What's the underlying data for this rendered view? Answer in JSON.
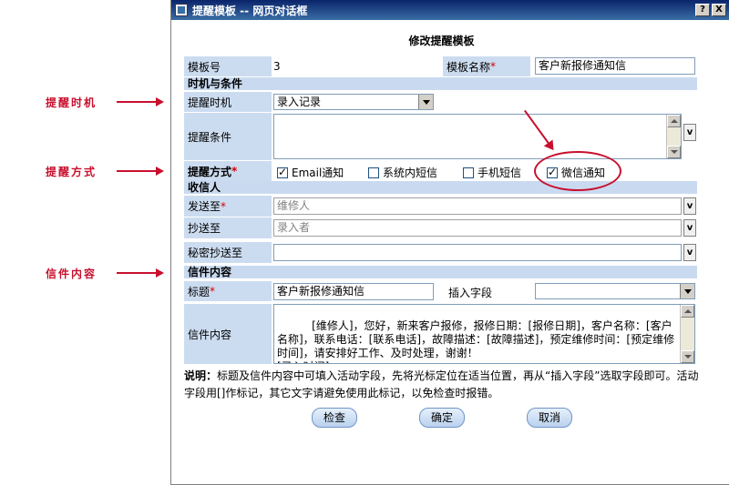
{
  "window": {
    "title": "提醒模板 -- 网页对话框",
    "help_btn": "?",
    "close_btn": "X"
  },
  "dialog_title": "修改提醒模板",
  "annotations": {
    "timing": "提醒时机",
    "method": "提醒方式",
    "content": "信件内容"
  },
  "fields": {
    "template_no_label": "模板号",
    "template_no_value": "3",
    "template_name_label": "模板名称",
    "template_name_value": "客户新报修通知信",
    "section_timing": "时机与条件",
    "timing_label": "提醒时机",
    "timing_value": "录入记录",
    "condition_label": "提醒条件",
    "condition_btn": "v",
    "method_label": "提醒方式",
    "method_email": "Email通知",
    "method_sms_internal": "系统内短信",
    "method_mobile": "手机短信",
    "method_wechat": "微信通知",
    "section_recipient": "收信人",
    "to_label": "发送至",
    "to_value": "维修人",
    "cc_label": "抄送至",
    "cc_value": "录入者",
    "bcc_label": "秘密抄送至",
    "bcc_value": "",
    "section_letter": "信件内容",
    "subject_label": "标题",
    "subject_value": "客户新报修通知信",
    "insert_field_label": "插入字段",
    "insert_field_value": "",
    "body_label": "信件内容",
    "body_value": "[维修人]，您好，新来客户报修，报修日期：[报修日期]，客户名称：[客户名称]，联系电话：[联系电话]，故障描述：[故障描述]，预定维修时间：[预定维修时间]，请安排好工作、及时处理，谢谢！\n[录入时间]",
    "required_mark": "*",
    "v_btn": "v"
  },
  "note": {
    "prefix": "说明：",
    "text": "标题及信件内容中可填入活动字段，先将光标定位在适当位置，再从“插入字段”选取字段即可。活动字段用[]作标记，其它文字请避免使用此标记，以免检查时报错。"
  },
  "buttons": {
    "check": "检查",
    "ok": "确定",
    "cancel": "取消"
  }
}
